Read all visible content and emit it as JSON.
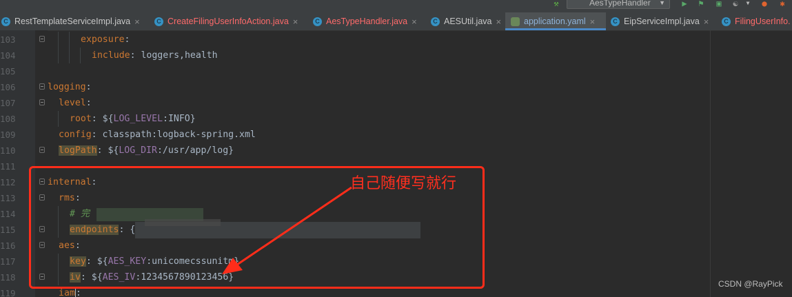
{
  "toolbar": {
    "run_config": "AesTypeHandler",
    "icons": [
      "hammer-icon",
      "run-icon",
      "debug-icon",
      "coverage-icon",
      "profiler-icon",
      "chevron-down-icon",
      "stop-icon",
      "pause-icon"
    ]
  },
  "tabs": [
    {
      "name": "RestTemplateServiceImpl.java",
      "icon": "C",
      "modified": false,
      "active": false
    },
    {
      "name": "CreateFilingUserInfoAction.java",
      "icon": "C",
      "modified": true,
      "active": false
    },
    {
      "name": "AesTypeHandler.java",
      "icon": "C",
      "modified": true,
      "active": false
    },
    {
      "name": "AESUtil.java",
      "icon": "C",
      "modified": false,
      "active": false
    },
    {
      "name": "application.yaml",
      "icon": "yaml",
      "modified": false,
      "active": true
    },
    {
      "name": "EipServiceImpl.java",
      "icon": "C",
      "modified": false,
      "active": false
    },
    {
      "name": "FilingUserInfo.",
      "icon": "C",
      "modified": true,
      "active": false
    }
  ],
  "editor": {
    "lines": [
      {
        "n": "103",
        "indent": 3,
        "key": "exposure",
        "colon": ":",
        "val": "",
        "fold": true
      },
      {
        "n": "104",
        "indent": 4,
        "key": "include",
        "colon": ": ",
        "val": "loggers,health",
        "fold": false
      },
      {
        "n": "105",
        "indent": 0,
        "key": "",
        "colon": "",
        "val": "",
        "fold": false
      },
      {
        "n": "106",
        "indent": 0,
        "key": "logging",
        "colon": ":",
        "val": "",
        "fold": true
      },
      {
        "n": "107",
        "indent": 1,
        "key": "level",
        "colon": ":",
        "val": "",
        "fold": true
      },
      {
        "n": "108",
        "indent": 2,
        "key": "root",
        "colon": ": ",
        "val": "${LOG_LEVEL:INFO}",
        "fold": false
      },
      {
        "n": "109",
        "indent": 1,
        "key": "config",
        "colon": ": ",
        "val": "classpath:logback-spring.xml",
        "fold": false
      },
      {
        "n": "110",
        "indent": 1,
        "key": "logPath",
        "colon": ": ",
        "val": "${LOG_DIR:/usr/app/log}",
        "fold": true
      },
      {
        "n": "111",
        "indent": 0,
        "key": "",
        "colon": "",
        "val": "",
        "fold": false
      },
      {
        "n": "112",
        "indent": 0,
        "key": "internal",
        "colon": ":",
        "val": "",
        "fold": true
      },
      {
        "n": "113",
        "indent": 1,
        "key": "rms",
        "colon": ":",
        "val": "",
        "fold": true
      },
      {
        "n": "114",
        "indent": 2,
        "key": "",
        "colon": "",
        "val": "# 完",
        "fold": false,
        "comment": true
      },
      {
        "n": "115",
        "indent": 2,
        "key": "endpoints",
        "colon": ": ",
        "val": "{",
        "fold": true
      },
      {
        "n": "116",
        "indent": 1,
        "key": "aes",
        "colon": ":",
        "val": "",
        "fold": true
      },
      {
        "n": "117",
        "indent": 2,
        "key": "key",
        "colon": ": ",
        "val": "${AES_KEY:unicomecssunit",
        "val2": "m}",
        "fold": false
      },
      {
        "n": "118",
        "indent": 2,
        "key": "iv",
        "colon": ": ",
        "val": "${AES_IV:1234567890123456}",
        "fold": true
      },
      {
        "n": "119",
        "indent": 1,
        "key": "iam",
        "colon": ":",
        "val": "",
        "fold": false
      }
    ]
  },
  "annotation": {
    "text": "自己随便写就行",
    "color": "#ff2d1a"
  },
  "watermark": "CSDN @RayPick"
}
